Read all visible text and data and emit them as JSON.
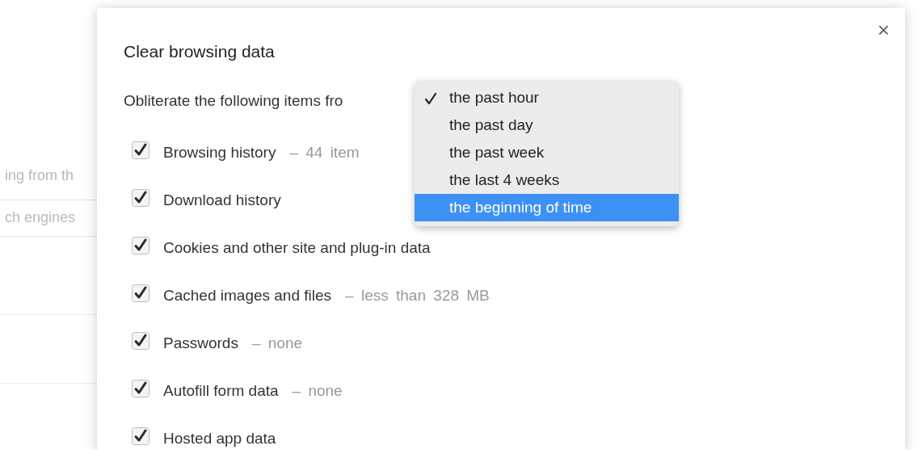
{
  "background": {
    "text": "ing from th",
    "field": {
      "value": "ch engines"
    }
  },
  "dialog": {
    "title": "Clear browsing data",
    "close": "×",
    "intro": "Obliterate the following items fro",
    "period_menu": {
      "items": [
        {
          "label": "the past hour",
          "checked": true,
          "selected": false
        },
        {
          "label": "the past day",
          "checked": false,
          "selected": false
        },
        {
          "label": "the past week",
          "checked": false,
          "selected": false
        },
        {
          "label": "the last 4 weeks",
          "checked": false,
          "selected": false
        },
        {
          "label": "the beginning of time",
          "checked": false,
          "selected": true
        }
      ]
    },
    "items": [
      {
        "label": "Browsing history",
        "detail": "– 44 item",
        "checked": true
      },
      {
        "label": "Download history",
        "checked": true
      },
      {
        "label": "Cookies and other site and plug-in data",
        "checked": true
      },
      {
        "label": "Cached images and files",
        "detail": "– less than 328 MB",
        "checked": true
      },
      {
        "label": "Passwords",
        "detail": "– none",
        "checked": true
      },
      {
        "label": "Autofill form data",
        "detail": "– none",
        "checked": true
      },
      {
        "label": "Hosted app data",
        "checked": true
      }
    ]
  }
}
